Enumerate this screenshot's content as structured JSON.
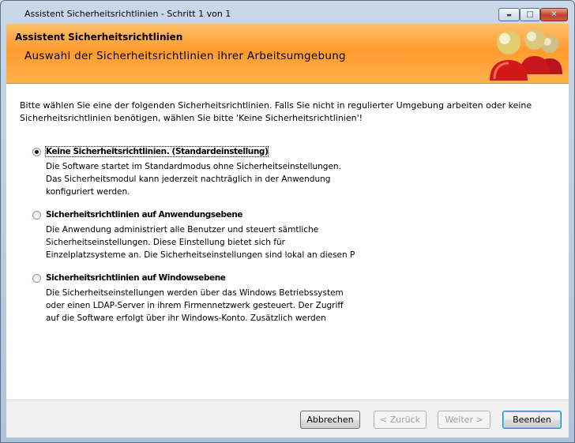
{
  "window": {
    "title": "Assistent Sicherheitsrichtlinien - Schritt 1 von 1"
  },
  "titlebar_buttons": {
    "minimize": "▬",
    "maximize": "□",
    "close": "✕"
  },
  "header": {
    "title": "Assistent Sicherheitsrichtlinien",
    "subtitle": "Auswahl der Sicherheitsrichtlinien ihrer Arbeitsumgebung"
  },
  "intro": {
    "line1": "Bitte wählen Sie eine der folgenden Sicherheitsrichtlinien. Falls Sie nicht in regulierter Umgebung arbeiten oder keine",
    "line2": "Sicherheitsrichtlinien benötigen, wählen Sie bitte 'Keine Sicherheitsrichtlinien'!"
  },
  "options": [
    {
      "label": "Keine Sicherheitsrichtlinien. (Standardeinstellung)",
      "selected": true,
      "desc": [
        "Die Software startet im Standardmodus ohne Sicherheitseinstellungen.",
        "Das Sicherheitsmodul kann jederzeit nachträglich in der Anwendung",
        "konfiguriert werden."
      ]
    },
    {
      "label": "Sicherheitsrichtlinien auf Anwendungsebene",
      "selected": false,
      "desc": [
        "Die Anwendung administriert alle Benutzer und steuert sämtliche",
        "Sicherheitseinstellungen. Diese Einstellung bietet sich für",
        "Einzelplatzsysteme an.  Die  Sicherheitseinstellungen  sind  lokal  an  diesen  P"
      ]
    },
    {
      "label": "Sicherheitsrichtlinien auf Windowsebene",
      "selected": false,
      "desc": [
        "Die Sicherheitseinstellungen werden über das Windows Betriebssystem",
        "oder einen LDAP-Server in ihrem Firmennetzwerk gesteuert. Der Zugriff",
        "auf die Software erfolgt über ihr Windows-Konto. Zusätzlich werden"
      ]
    }
  ],
  "buttons": {
    "cancel": "Abbrechen",
    "back": "< Zurück",
    "next": "Weiter >",
    "finish": "Beenden"
  },
  "colors": {
    "header_orange": "#ff9b2e",
    "people_red": "#d01a1a",
    "head_gold": "#e8d27a"
  }
}
